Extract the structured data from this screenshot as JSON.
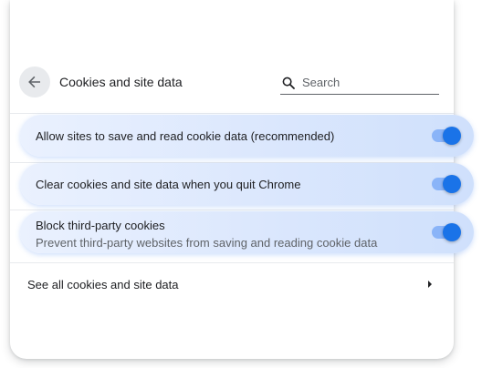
{
  "header": {
    "title": "Cookies and site data",
    "back_icon": "arrow-back-icon",
    "search_icon": "search-icon",
    "search_placeholder": "Search"
  },
  "settings": [
    {
      "label": "Allow sites to save and read cookie data (recommended)",
      "enabled": true
    },
    {
      "label": "Clear cookies and site data when you quit Chrome",
      "enabled": true
    },
    {
      "label": "Block third-party cookies",
      "sublabel": "Prevent third-party websites from saving and reading cookie data",
      "enabled": true
    }
  ],
  "see_all": {
    "label": "See all cookies and site data",
    "icon": "arrow-right-icon"
  },
  "colors": {
    "toggle_on_track": "#8ab4f8",
    "toggle_on_knob": "#1a73e8",
    "highlight": "#dbe7fd"
  }
}
